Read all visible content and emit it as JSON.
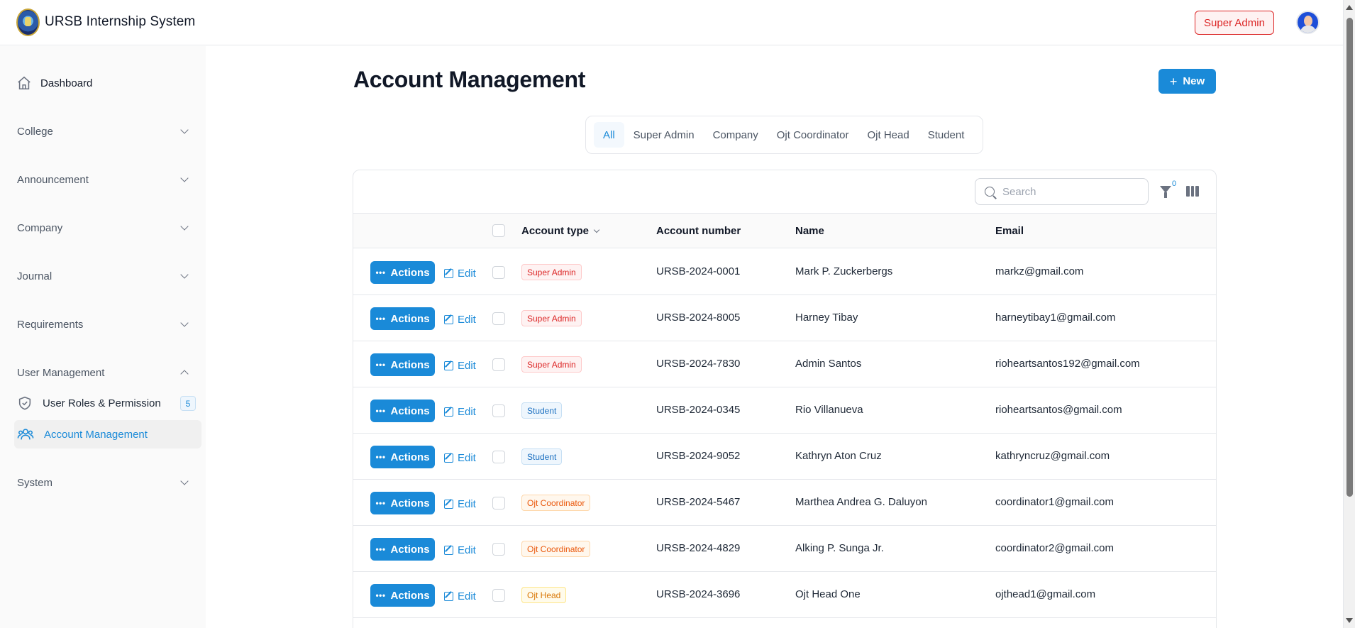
{
  "app": {
    "title": "URSB Internship System",
    "role_badge": "Super Admin"
  },
  "sidebar": {
    "dashboard": "Dashboard",
    "groups": [
      {
        "label": "College",
        "expanded": false
      },
      {
        "label": "Announcement",
        "expanded": false
      },
      {
        "label": "Company",
        "expanded": false
      },
      {
        "label": "Journal",
        "expanded": false
      },
      {
        "label": "Requirements",
        "expanded": false
      },
      {
        "label": "User Management",
        "expanded": true
      },
      {
        "label": "System",
        "expanded": false
      }
    ],
    "user_management_items": [
      {
        "label": "User Roles & Permission",
        "badge": "5",
        "icon": "shield-check-icon"
      },
      {
        "label": "Account Management",
        "icon": "users-icon",
        "active": true
      }
    ]
  },
  "page": {
    "title": "Account Management",
    "new_label": "New"
  },
  "tabs": [
    "All",
    "Super Admin",
    "Company",
    "Ojt Coordinator",
    "Ojt Head",
    "Student"
  ],
  "active_tab": "All",
  "toolbar": {
    "search_placeholder": "Search",
    "filter_count": "0"
  },
  "table": {
    "columns": [
      "Account type",
      "Account number",
      "Name",
      "Email"
    ],
    "action_label": "Actions",
    "edit_label": "Edit",
    "rows": [
      {
        "type": "Super Admin",
        "tone": "red",
        "number": "URSB-2024-0001",
        "name": "Mark P. Zuckerbergs",
        "email": "markz@gmail.com"
      },
      {
        "type": "Super Admin",
        "tone": "red",
        "number": "URSB-2024-8005",
        "name": "Harney Tibay",
        "email": "harneytibay1@gmail.com"
      },
      {
        "type": "Super Admin",
        "tone": "red",
        "number": "URSB-2024-7830",
        "name": "Admin Santos",
        "email": "rioheartsantos192@gmail.com"
      },
      {
        "type": "Student",
        "tone": "blue",
        "number": "URSB-2024-0345",
        "name": "Rio Villanueva",
        "email": "rioheartsantos@gmail.com"
      },
      {
        "type": "Student",
        "tone": "blue",
        "number": "URSB-2024-9052",
        "name": "Kathryn Aton Cruz",
        "email": "kathryncruz@gmail.com"
      },
      {
        "type": "Ojt Coordinator",
        "tone": "orange",
        "number": "URSB-2024-5467",
        "name": "Marthea Andrea G. Daluyon",
        "email": "coordinator1@gmail.com"
      },
      {
        "type": "Ojt Coordinator",
        "tone": "orange",
        "number": "URSB-2024-4829",
        "name": "Alking P. Sunga Jr.",
        "email": "coordinator2@gmail.com"
      },
      {
        "type": "Ojt Head",
        "tone": "gold",
        "number": "URSB-2024-3696",
        "name": "Ojt Head One",
        "email": "ojthead1@gmail.com"
      }
    ]
  },
  "colors": {
    "accent": "#1a8ad8",
    "danger": "#dc2626",
    "orange": "#ea580c",
    "gold": "#d97706"
  }
}
